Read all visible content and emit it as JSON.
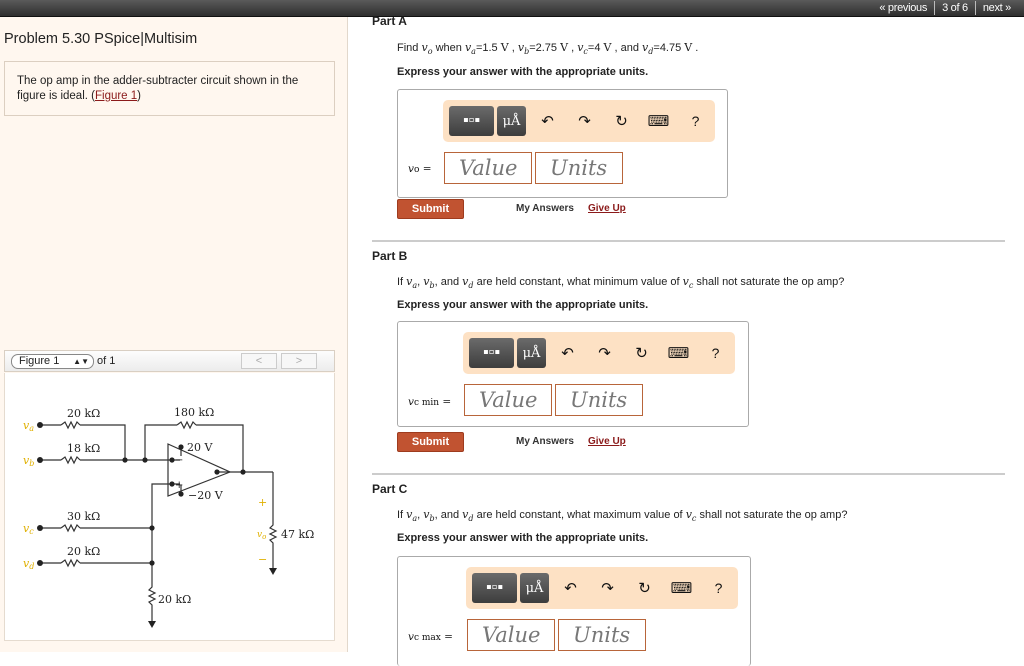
{
  "topnav": {
    "previous": "« previous",
    "position": "3 of 6",
    "next": "next »"
  },
  "problem": {
    "title": "Problem 5.30 PSpice|Multisim",
    "text_before": "The op amp in the adder-subtracter circuit shown in the figure is ideal. (",
    "figure_link": "Figure 1",
    "text_after": ")"
  },
  "figure": {
    "selected": "Figure 1",
    "of_label": "of 1",
    "prev_label": "<",
    "next_label": ">",
    "labels": {
      "va": "v",
      "va_sub": "a",
      "vb": "v",
      "vb_sub": "b",
      "vc": "v",
      "vc_sub": "c",
      "vd": "v",
      "vd_sub": "d",
      "vo": "v",
      "vo_sub": "o",
      "r_a": "20 kΩ",
      "r_b": "18 kΩ",
      "r_f": "180 kΩ",
      "r_c": "30 kΩ",
      "r_d": "20 kΩ",
      "r_g": "20 kΩ",
      "r_l": "47 kΩ",
      "vpos": "20 V",
      "vneg": "−20 V",
      "plus": "+",
      "minus": "−",
      "in_minus": "−",
      "in_plus": "+"
    },
    "label_color": "#e0b000"
  },
  "parts": [
    {
      "title": "Part A",
      "question": {
        "pre": "Find ",
        "var": "v",
        "sub": "o",
        "rest": " when v_a=1.5 V , v_b=2.75 V , v_c=4 V , and v_d=4.75 V ."
      },
      "question_parts": [
        "Find ",
        "v",
        "o",
        " when ",
        "v",
        "a",
        "=1.5 ",
        "V",
        " , ",
        "v",
        "b",
        "=2.75 ",
        "V",
        " , ",
        "v",
        "c",
        "=4 ",
        "V",
        " , and ",
        "v",
        "d",
        "=4.75 ",
        "V",
        " ."
      ],
      "instruction": "Express your answer with the appropriate units.",
      "label_var": "v",
      "label_sub": "o",
      "label_eq": " =",
      "value_placeholder": "Value",
      "units_placeholder": "Units",
      "submit": "Submit",
      "my_answers": "My Answers",
      "give_up": "Give Up"
    },
    {
      "title": "Part B",
      "question_parts": [
        "If ",
        "v",
        "a",
        ", ",
        "v",
        "b",
        ", and ",
        "v",
        "d",
        " are held constant, what minimum value of ",
        "v",
        "c",
        " shall not saturate the op amp?"
      ],
      "instruction": "Express your answer with the appropriate units.",
      "label_var": "v",
      "label_sub": "c min",
      "label_eq": " =",
      "value_placeholder": "Value",
      "units_placeholder": "Units",
      "submit": "Submit",
      "my_answers": "My Answers",
      "give_up": "Give Up"
    },
    {
      "title": "Part C",
      "question_parts": [
        "If ",
        "v",
        "a",
        ", ",
        "v",
        "b",
        ", and ",
        "v",
        "d",
        " are held constant, what maximum value of ",
        "v",
        "c",
        " shall not saturate the op amp?"
      ],
      "instruction": "Express your answer with the appropriate units.",
      "label_var": "v",
      "label_sub": "c max",
      "label_eq": " =",
      "value_placeholder": "Value",
      "units_placeholder": "Units"
    }
  ],
  "toolbar": {
    "template_icon": "templates-icon",
    "units_label": "μÅ",
    "undo": "↶",
    "redo": "↷",
    "reset": "↻",
    "keyboard": "⌨",
    "help": "?"
  },
  "colors": {
    "accent": "#c15331",
    "toolbar_bg": "#fde1c4",
    "input_border": "#b8653a",
    "link": "#8b1a1a",
    "panel_bg": "#fff7ef"
  }
}
